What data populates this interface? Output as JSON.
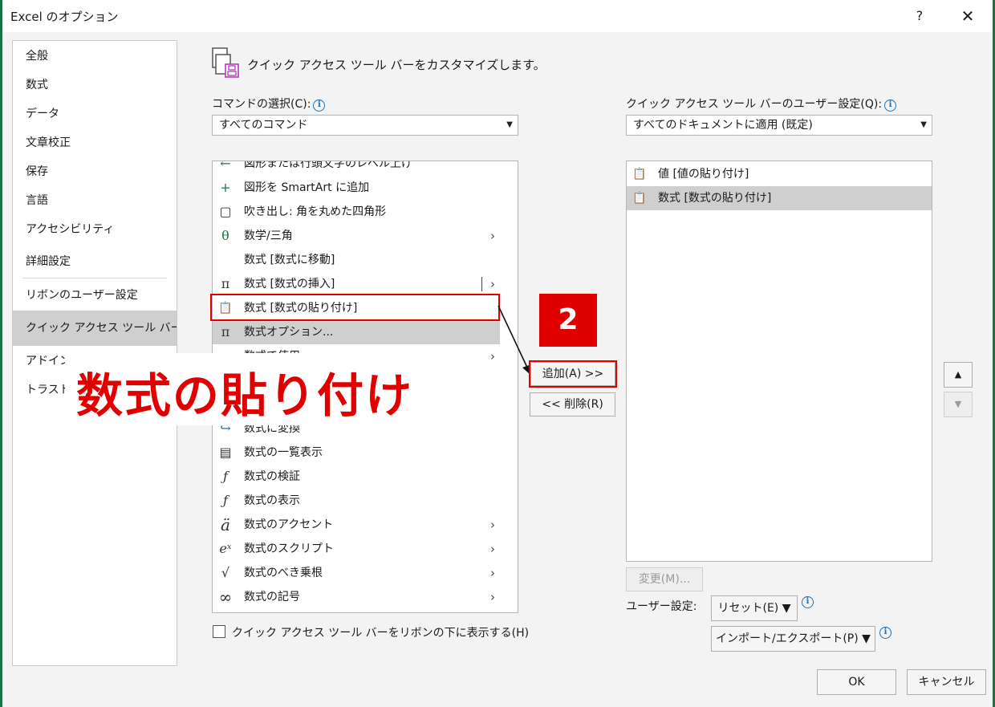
{
  "window": {
    "title": "Excel のオプション",
    "help": "?",
    "close": "✕"
  },
  "nav": {
    "items": [
      {
        "label": "全般"
      },
      {
        "label": "数式"
      },
      {
        "label": "データ"
      },
      {
        "label": "文章校正"
      },
      {
        "label": "保存"
      },
      {
        "label": "言語"
      },
      {
        "label": "アクセシビリティ"
      },
      {
        "label": "詳細設定"
      },
      {
        "label": "リボンのユーザー設定"
      },
      {
        "label": "クイック アクセス ツール バー",
        "selected": true
      },
      {
        "label": "アドイン"
      },
      {
        "label": "トラスト"
      }
    ]
  },
  "main": {
    "heading": "クイック アクセス ツール バーをカスタマイズします。",
    "choose_label": "コマンドの選択(C):",
    "choose_value": "すべてのコマンド",
    "customize_label": "クイック アクセス ツール バーのユーザー設定(Q):",
    "customize_value": "すべてのドキュメントに適用 (既定)",
    "commands": [
      {
        "icon": "←",
        "label": "図形または行頭文字のレベル上げ"
      },
      {
        "icon": "+",
        "label": "図形を SmartArt に追加"
      },
      {
        "icon": "▢",
        "label": "吹き出し: 角を丸めた四角形"
      },
      {
        "icon": "θ",
        "label": "数学/三角",
        "submenu": "›"
      },
      {
        "icon": "",
        "label": "数式 [数式に移動]"
      },
      {
        "icon": "π",
        "label": "数式 [数式の挿入]",
        "submenu": "›"
      },
      {
        "icon": "📋",
        "label": "数式 [数式の貼り付け]"
      },
      {
        "icon": "π",
        "label": "数式オプション...",
        "selected": true
      },
      {
        "icon": "⊿",
        "label": "数式で使用",
        "submenu": "›"
      },
      {
        "icon": "",
        "label": ""
      },
      {
        "icon": "",
        "label": ""
      },
      {
        "icon": "↪",
        "label": "数式に変換"
      },
      {
        "icon": "▤",
        "label": "数式の一覧表示"
      },
      {
        "icon": "ƒ",
        "label": "数式の検証"
      },
      {
        "icon": "ƒ",
        "label": "数式の表示"
      },
      {
        "icon": "ä",
        "label": "数式のアクセント",
        "submenu": "›"
      },
      {
        "icon": "eˣ",
        "label": "数式のスクリプト",
        "submenu": "›"
      },
      {
        "icon": "√",
        "label": "数式のべき乗根",
        "submenu": "›"
      },
      {
        "icon": "∞",
        "label": "数式の記号",
        "submenu": "›"
      }
    ],
    "add_button": "追加(A) >>",
    "remove_button": "<< 削除(R)",
    "qat_items": [
      {
        "icon": "📋",
        "label": "値 [値の貼り付け]"
      },
      {
        "icon": "📋",
        "label": "数式 [数式の貼り付け]",
        "selected": true
      }
    ],
    "modify_button": "変更(M)...",
    "user_settings_label": "ユーザー設定:",
    "reset_button": "リセット(E) ▼",
    "import_export_button": "インポート/エクスポート(P) ▼",
    "below_ribbon_checkbox": "クイック アクセス ツール バーをリボンの下に表示する(H)",
    "move_up": "▲",
    "move_down": "▼"
  },
  "footer": {
    "ok": "OK",
    "cancel": "キャンセル"
  },
  "annotations": {
    "step_number": "2",
    "callout": "数式の貼り付け"
  },
  "colors": {
    "accent_red": "#e10000",
    "selected_gray": "#cfcfcf",
    "excel_green": "#1e7145"
  }
}
